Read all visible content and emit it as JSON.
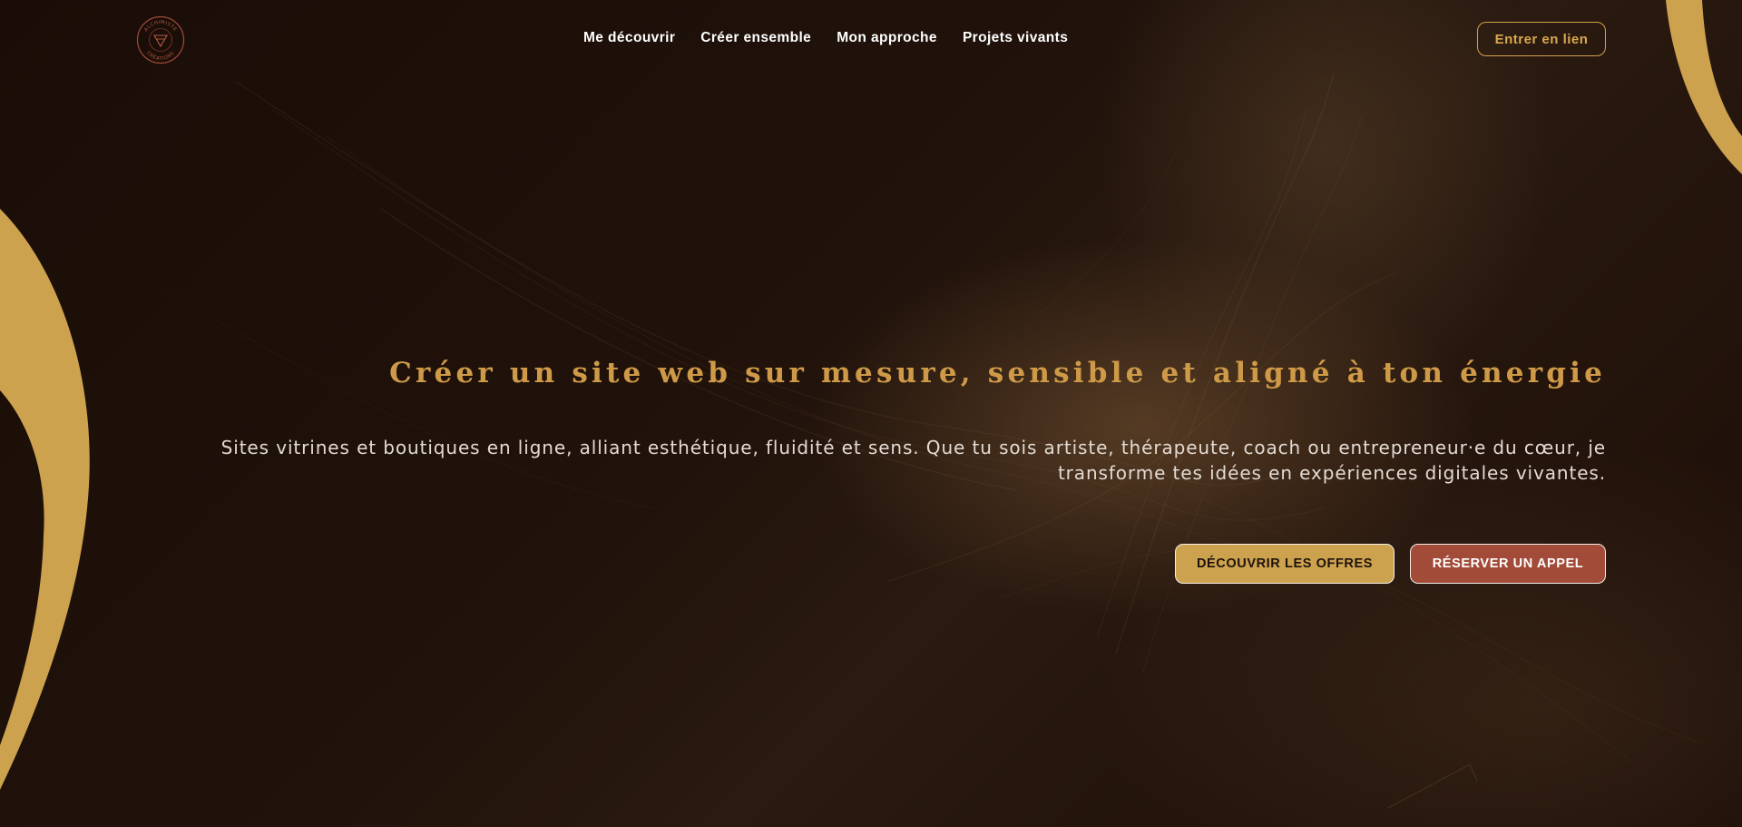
{
  "brand": {
    "logo_text_top": "ALCHIMISTE",
    "logo_text_bottom": "CRÉATIONS",
    "logo_icon": "triangle-emblem-icon"
  },
  "nav": {
    "items": [
      {
        "label": "Me découvrir"
      },
      {
        "label": "Créer ensemble"
      },
      {
        "label": "Mon approche"
      },
      {
        "label": "Projets vivants"
      }
    ],
    "cta_label": "Entrer en lien"
  },
  "hero": {
    "title": "Créer un site web sur mesure, sensible et aligné à ton énergie",
    "subtitle_line1": "Sites vitrines et boutiques en ligne, alliant esthétique, fluidité et sens. Que tu sois artiste, thérapeute, coach ou entrepreneur·e du cœur, je",
    "subtitle_line2": "transforme tes idées en expériences digitales vivantes.",
    "primary_button": "DÉCOUVRIR LES OFFRES",
    "secondary_button": "RÉSERVER UN APPEL"
  },
  "colors": {
    "background": "#170b06",
    "gold": "#cda24e",
    "title_gold": "#cf9a48",
    "terracotta": "#a24b39",
    "text_light": "#e3dad2"
  }
}
